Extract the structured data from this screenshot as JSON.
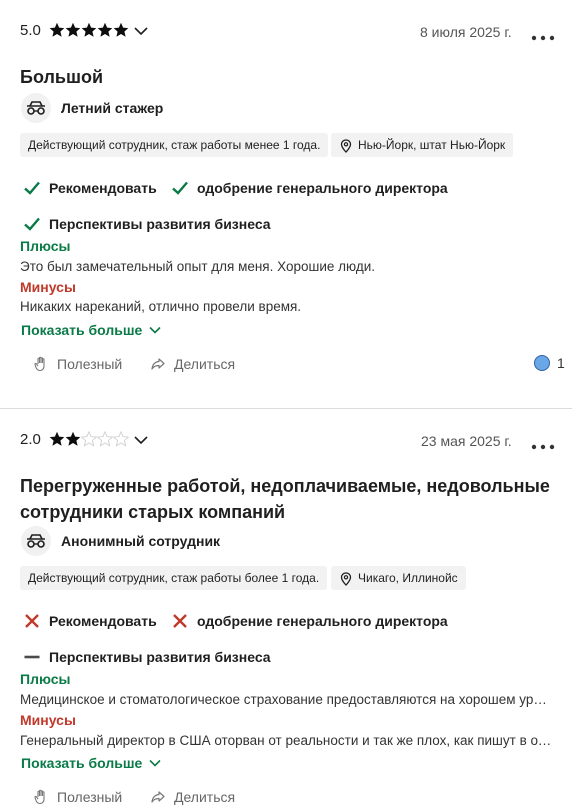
{
  "reviews": [
    {
      "rating_value": "5.0",
      "stars": 5,
      "date": "8 июля 2025 г.",
      "title": "Большой",
      "author": "Летний стажер",
      "employment_chip": "Действующий сотрудник, стаж работы менее 1 года.",
      "location_chip": "Нью-Йорк, штат Нью-Йорк",
      "recommend": {
        "label": "Рекомендовать",
        "status": "positive"
      },
      "ceo": {
        "label": "одобрение генерального директора",
        "status": "positive"
      },
      "outlook": {
        "label": "Перспективы развития бизнеса",
        "status": "positive"
      },
      "pros_label": "Плюсы",
      "pros_text": "Это был замечательный опыт для меня. Хорошие люди.",
      "cons_label": "Минусы",
      "cons_text": "Никаких нареканий, отлично провели время.",
      "show_more": "Показать больше",
      "helpful_label": "Полезный",
      "share_label": "Делиться",
      "helpful_count": "1"
    },
    {
      "rating_value": "2.0",
      "stars": 2,
      "date": "23 мая 2025 г.",
      "title_line1": "Перегруженные работой, недоплачиваемые, недовольные",
      "title_line2": "сотрудники старых компаний",
      "author": "Анонимный сотрудник",
      "employment_chip": "Действующий сотрудник, стаж работы более 1 года.",
      "location_chip": "Чикаго, Иллинойс",
      "recommend": {
        "label": "Рекомендовать",
        "status": "negative"
      },
      "ceo": {
        "label": "одобрение генерального директора",
        "status": "negative"
      },
      "outlook": {
        "label": "Перспективы развития бизнеса",
        "status": "neutral"
      },
      "pros_label": "Плюсы",
      "pros_text": "Медицинское и стоматологическое страхование предоставляются на хорошем уровне, отпуск",
      "cons_label": "Минусы",
      "cons_text": "Генеральный директор в США оторван от реальности и так же плох, как пишут в отзывах",
      "show_more": "Показать больше",
      "helpful_label": "Полезный",
      "share_label": "Делиться"
    }
  ],
  "colors": {
    "green": "#0a7a47",
    "red": "#c0392b",
    "star": "#0d0d0d"
  }
}
